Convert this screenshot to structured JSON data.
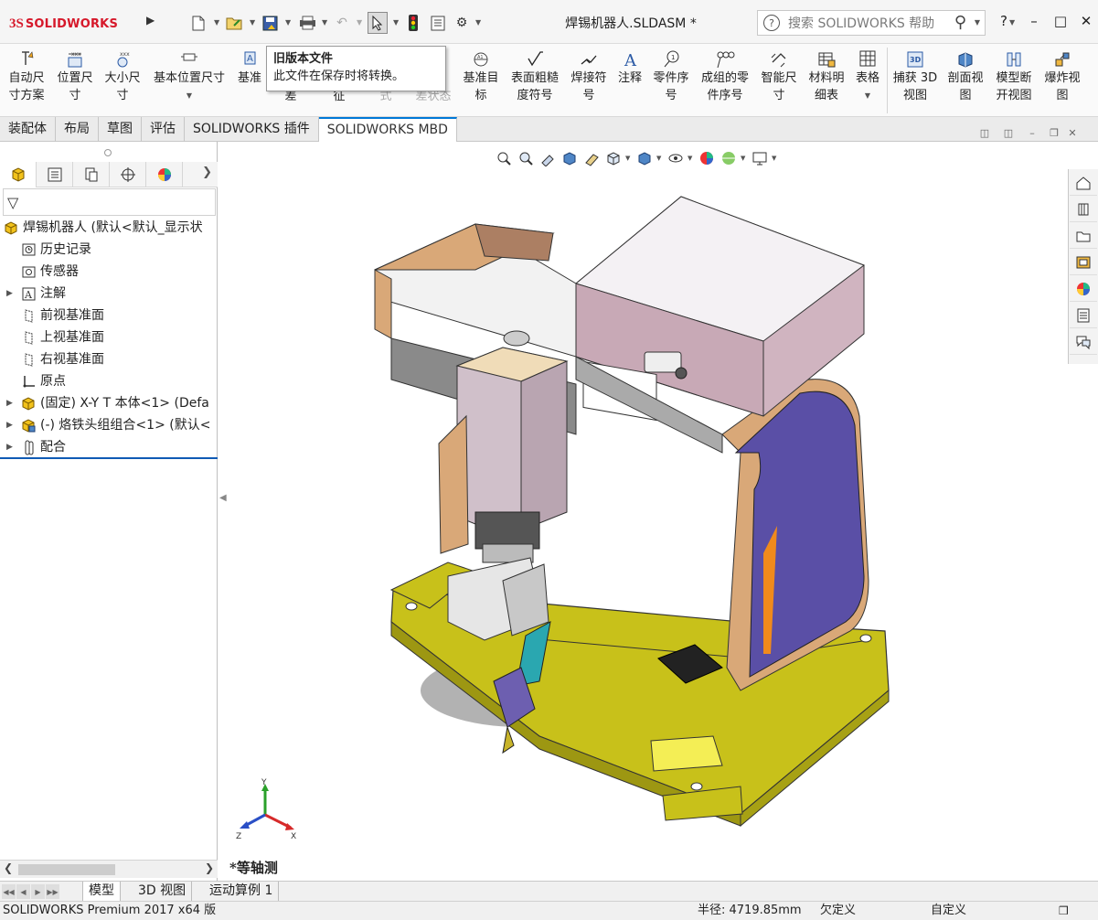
{
  "titlebar": {
    "logo_ds": "3S",
    "logo_brand": "SOLIDWORKS",
    "document_title": "焊锡机器人.SLDASM *",
    "search_placeholder": "搜索 SOLIDWORKS 帮助",
    "help_label": "?"
  },
  "ribbon": {
    "buttons": [
      {
        "label": "自动尺\n寸方案",
        "icon": "auto-dimension-icon"
      },
      {
        "label": "位置尺\n寸",
        "icon": "location-dimension-icon"
      },
      {
        "label": "大小尺\n寸",
        "icon": "size-dimension-icon"
      },
      {
        "label": "基本位置尺寸",
        "icon": "basic-location-dimension-icon"
      },
      {
        "label": "基准",
        "icon": "datum-icon"
      },
      {
        "label": "差",
        "icon": ""
      },
      {
        "label": "征",
        "icon": ""
      },
      {
        "label": "式",
        "icon": ""
      },
      {
        "label": "差状态",
        "icon": ""
      },
      {
        "label": "基准目\n标",
        "icon": "datum-target-icon"
      },
      {
        "label": "表面粗糙\n度符号",
        "icon": "surface-finish-icon"
      },
      {
        "label": "焊接符\n号",
        "icon": "weld-symbol-icon"
      },
      {
        "label": "注释",
        "icon": "note-icon"
      },
      {
        "label": "零件序\n号",
        "icon": "balloon-icon"
      },
      {
        "label": "成组的零\n件序号",
        "icon": "stacked-balloon-icon"
      },
      {
        "label": "智能尺\n寸",
        "icon": "smart-dimension-icon"
      },
      {
        "label": "材料明\n细表",
        "icon": "bom-icon"
      },
      {
        "label": "表格",
        "icon": "table-icon"
      },
      {
        "label": "捕获 3D\n视图",
        "icon": "capture-3d-view-icon"
      },
      {
        "label": "剖面视\n图",
        "icon": "section-view-icon"
      },
      {
        "label": "模型断\n开视图",
        "icon": "model-break-view-icon"
      },
      {
        "label": "爆炸视\n图",
        "icon": "exploded-view-icon"
      }
    ]
  },
  "tooltip": {
    "title": "旧版本文件",
    "body": "此文件在保存时将转换。"
  },
  "tabs": [
    {
      "label": "装配体",
      "active": false
    },
    {
      "label": "布局",
      "active": false
    },
    {
      "label": "草图",
      "active": false
    },
    {
      "label": "评估",
      "active": false
    },
    {
      "label": "SOLIDWORKS 插件",
      "active": false
    },
    {
      "label": "SOLIDWORKS MBD",
      "active": true
    }
  ],
  "tree": {
    "items": [
      {
        "label": "焊锡机器人 (默认<默认_显示状",
        "icon": "assembly-icon",
        "expand": false,
        "indent": 0
      },
      {
        "label": "历史记录",
        "icon": "history-icon",
        "expand": false,
        "indent": 1
      },
      {
        "label": "传感器",
        "icon": "sensor-icon",
        "expand": false,
        "indent": 1
      },
      {
        "label": "注解",
        "icon": "annotation-icon",
        "expand": true,
        "indent": 1
      },
      {
        "label": "前视基准面",
        "icon": "plane-icon",
        "expand": false,
        "indent": 1
      },
      {
        "label": "上视基准面",
        "icon": "plane-icon",
        "expand": false,
        "indent": 1
      },
      {
        "label": "右视基准面",
        "icon": "plane-icon",
        "expand": false,
        "indent": 1
      },
      {
        "label": "原点",
        "icon": "origin-icon",
        "expand": false,
        "indent": 1
      },
      {
        "label": "(固定) X-Y T 本体<1> (Defa",
        "icon": "part-icon",
        "expand": true,
        "indent": 1
      },
      {
        "label": "(-) 烙铁头组组合<1> (默认<",
        "icon": "subassembly-icon",
        "expand": true,
        "indent": 1
      },
      {
        "label": "配合",
        "icon": "mates-icon",
        "expand": true,
        "indent": 1
      }
    ]
  },
  "viewport": {
    "view_name": "*等轴测",
    "axis_x": "X",
    "axis_y": "Y",
    "axis_z": "Z"
  },
  "bottom_tabs": [
    {
      "label": "模型",
      "active": true
    },
    {
      "label": "3D 视图",
      "active": false
    },
    {
      "label": "运动算例 1",
      "active": false
    }
  ],
  "status": {
    "product": "SOLIDWORKS Premium 2017 x64 版",
    "radius": "半径: 4719.85mm",
    "state": "欠定义",
    "custom": "自定义"
  },
  "colors": {
    "accent_blue": "#0f5bb5",
    "brand_red": "#d6182a",
    "base_yellow": "#c8c11a",
    "side_purple": "#5a4fa6",
    "tan": "#d9a878"
  }
}
